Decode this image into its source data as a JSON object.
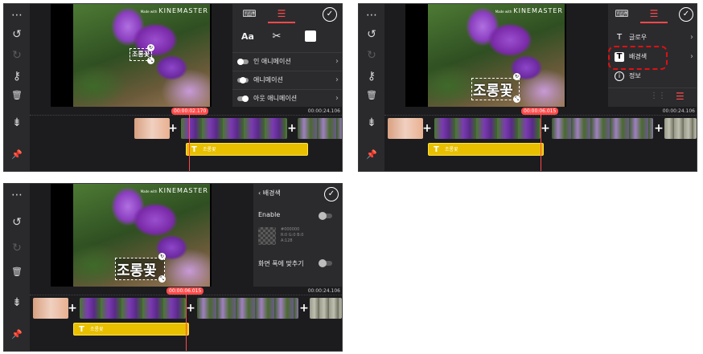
{
  "common": {
    "watermark_small": "Made with",
    "watermark": "KINEMASTER",
    "end_time": "00:00:24.106",
    "caption": "조롱꽃",
    "text_clip_label": "조롱꽃",
    "text_clip_icon": "T",
    "check_glyph": "✓",
    "plus_glyph": "+",
    "left_icons": {
      "more": "⋯",
      "undo": "↺",
      "redo": "↻",
      "key": "⚷",
      "trash": "🗑",
      "layers": "⇟",
      "pin": "📌"
    }
  },
  "panel1": {
    "timecode": "00:00:02.170",
    "tools": {
      "font": "Aa",
      "scissors": "✂"
    },
    "animations": [
      {
        "label": "인 애니메이션"
      },
      {
        "label": "애니메이션"
      },
      {
        "label": "아웃 애니메이션"
      }
    ]
  },
  "panel2": {
    "timecode": "00:00:06.015",
    "menu": [
      {
        "icon": "T",
        "label": "글로우"
      },
      {
        "icon": "T",
        "label": "배경색"
      },
      {
        "icon": "i",
        "label": "정보"
      }
    ]
  },
  "panel3": {
    "timecode": "00:00:06.015",
    "back_glyph": "‹",
    "title": "배경색",
    "enable_label": "Enable",
    "hex_lines": [
      "#000000",
      "R:0 G:0 B:0",
      "A:128"
    ],
    "fit_label": "화면 폭에 맞추기"
  },
  "colors": {
    "accent": "#ff4a4a",
    "text_track": "#e8c000",
    "highlight": "#e01010"
  }
}
